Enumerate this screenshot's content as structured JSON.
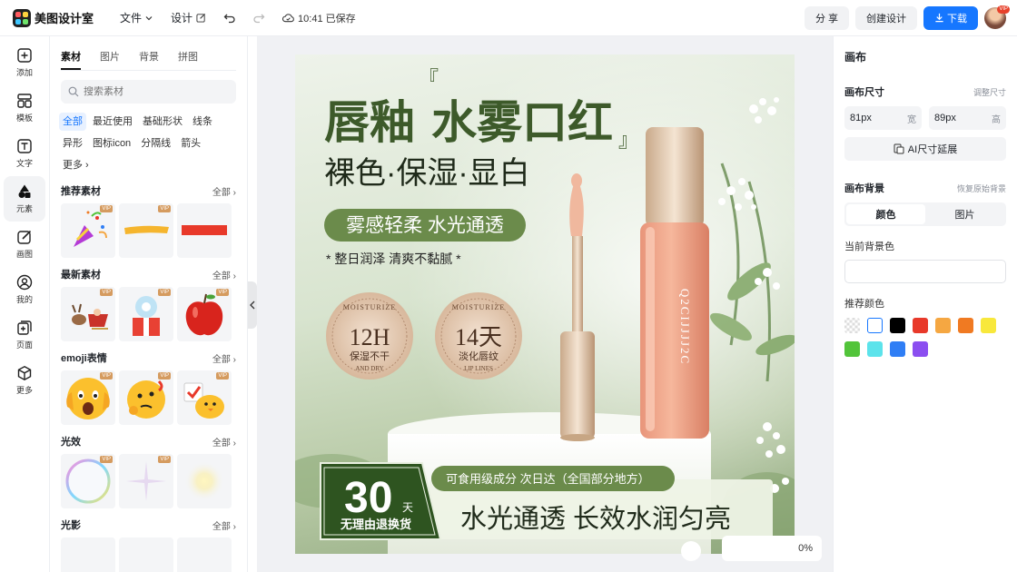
{
  "app": {
    "name": "美图设计室"
  },
  "topbar": {
    "file_menu": "文件",
    "design_menu": "设计",
    "saved_status": "10:41 已保存",
    "share_label": "分 享",
    "create_label": "创建设计",
    "download_label": "下载",
    "avatar_badge": "VIP"
  },
  "rail": {
    "items": [
      {
        "label": "添加",
        "icon": "plus-square-icon"
      },
      {
        "label": "模板",
        "icon": "template-icon"
      },
      {
        "label": "文字",
        "icon": "text-icon"
      },
      {
        "label": "元素",
        "icon": "shapes-icon"
      },
      {
        "label": "画图",
        "icon": "draw-icon"
      },
      {
        "label": "我的",
        "icon": "user-icon"
      },
      {
        "label": "页面",
        "icon": "page-add-icon"
      },
      {
        "label": "更多",
        "icon": "cube-icon"
      }
    ],
    "active_index": 3
  },
  "panel": {
    "tabs": [
      "素材",
      "图片",
      "背景",
      "拼图"
    ],
    "active_tab": 0,
    "search_placeholder": "搜索素材",
    "chips": [
      "全部",
      "最近使用",
      "基础形状",
      "线条",
      "异形",
      "图标icon",
      "分隔线",
      "箭头",
      "更多"
    ],
    "active_chip": 0,
    "sections": [
      {
        "title": "推荐素材",
        "all": "全部",
        "items": [
          "party-popper",
          "yellow-brush-stroke",
          "red-brush-stroke"
        ],
        "vip": [
          true,
          true,
          false
        ]
      },
      {
        "title": "最新素材",
        "all": "全部",
        "items": [
          "reindeer-sleigh",
          "christmas-gift-box",
          "red-apple"
        ],
        "vip": [
          true,
          true,
          true
        ]
      },
      {
        "title": "emoji表情",
        "all": "全部",
        "items": [
          "scared-emoji",
          "thinking-emoji",
          "chick-emoji"
        ],
        "vip": [
          true,
          true,
          true
        ]
      },
      {
        "title": "光效",
        "all": "全部",
        "items": [
          "rainbow-bubble",
          "sparkle-star",
          "glow-dot"
        ],
        "vip": [
          true,
          true,
          false
        ]
      },
      {
        "title": "光影",
        "all": "全部"
      }
    ],
    "vip_label": "VIP"
  },
  "canvas": {
    "headline_a": "唇釉",
    "headline_b": "水雾口红",
    "subheadline": "裸色·保湿·显白",
    "pill_text": "雾感轻柔 水光通透",
    "tagline": "* 整日润泽 清爽不黏腻 *",
    "badge1": {
      "arc_top": "MOISTURIZE",
      "big": "12H",
      "small": "保湿不干",
      "arc_bottom": "AND DRY"
    },
    "badge2": {
      "arc_top": "MOISTURIZE",
      "big": "14天",
      "small": "淡化唇纹",
      "arc_bottom": "LIP LINES"
    },
    "tube_brand": "Q2CIJJJJ2C",
    "return_number": "30",
    "return_unit": "天",
    "return_text": "无理由退换货",
    "banner_small": "可食用级成分  次日达（全国部分地方）",
    "banner_big": "水光通透  长效水润匀亮"
  },
  "stage": {
    "zoom": "0%"
  },
  "props": {
    "title": "画布",
    "size_label": "画布尺寸",
    "size_adjust": "调整尺寸",
    "width_value": "81px",
    "width_unit": "宽",
    "height_value": "89px",
    "height_unit": "高",
    "ai_extend": "AI尺寸延展",
    "bg_label": "画布背景",
    "bg_restore": "恢复原始背景",
    "seg_color": "颜色",
    "seg_image": "图片",
    "current_bg_label": "当前背景色",
    "recommend_label": "推荐颜色",
    "swatches": [
      "transparent",
      "#ffffff",
      "#000000",
      "#e8392a",
      "#f5a742",
      "#f07a22",
      "#f8e83c",
      "#52c43a",
      "#5ce3eb",
      "#2f7ef5",
      "#8b4ef0"
    ]
  }
}
